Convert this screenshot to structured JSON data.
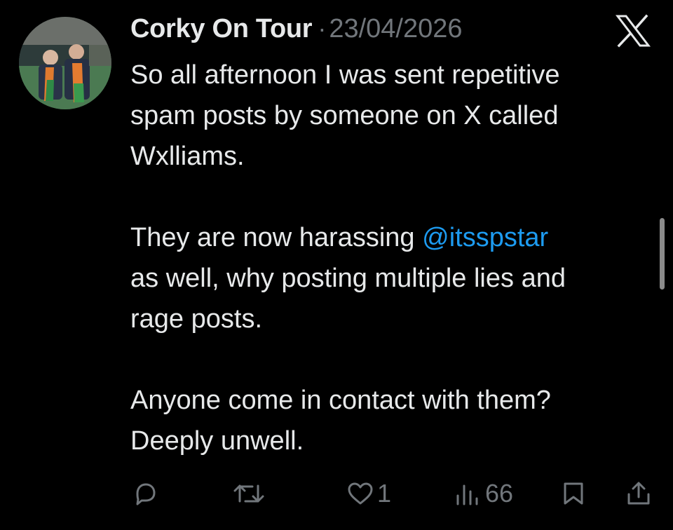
{
  "post": {
    "author_name": "Corky On Tour",
    "separator": "·",
    "date": "23/04/2026",
    "lines": [
      "So all afternoon I was sent repetitive",
      "spam posts by someone on X called",
      "Wxlliams.",
      "They are now harassing",
      "@itsspstar",
      "as well, why posting multiple lies and",
      "rage posts.",
      "Anyone come in contact with them?",
      "Deeply unwell."
    ]
  },
  "actions": {
    "reply": {
      "icon": "reply-icon"
    },
    "repost": {
      "icon": "repost-icon"
    },
    "like": {
      "icon": "heart-icon",
      "count": "1"
    },
    "views": {
      "icon": "views-chart-icon",
      "count": "66"
    },
    "bookmark": {
      "icon": "bookmark-icon"
    },
    "share": {
      "icon": "share-icon"
    }
  },
  "brand": {
    "logo": "x-logo-icon"
  },
  "colors": {
    "background": "#000000",
    "text": "#e7e9ea",
    "muted": "#71767b",
    "mention": "#1d9bf0"
  }
}
